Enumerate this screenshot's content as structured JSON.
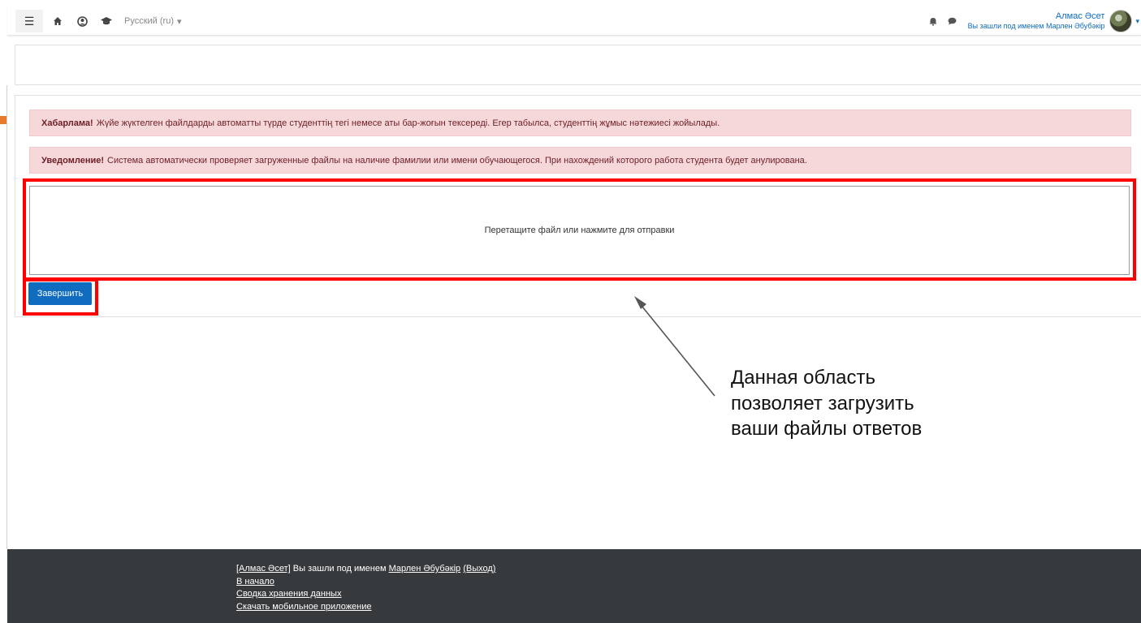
{
  "navbar": {
    "language": "Русский (ru)",
    "user_name": "Алмас Әсет",
    "logged_in_as": "Вы зашли под именем Марлен Әбубәкір"
  },
  "alerts": {
    "kz": {
      "label": "Хабарлама!",
      "text": "Жүйе жүктелген файлдарды автоматты түрде студенттің тегі немесе аты бар-жоғын тексереді. Егер табылса, студенттің жұмыс нәтежиесі жойылады."
    },
    "ru": {
      "label": "Уведомление!",
      "text": "Система автоматически проверяет загруженные файлы на наличие фамилии или имени обучающегося. При нахождений которого работа студента будет анулирована."
    }
  },
  "upload": {
    "dropzone_text": "Перетащите файл или нажмите для отправки",
    "finish_label": "Завершить"
  },
  "annotation": {
    "line1": "Данная область",
    "line2": "позволяет загрузить",
    "line3": "ваши файлы ответов"
  },
  "footer": {
    "user_link": "[Алмас Әсет]",
    "login_text": " Вы зашли под именем ",
    "login_user_link": "Марлен Әбубәкір",
    "logout_link": "(Выход)",
    "home_link": "В начало",
    "data_retention_link": "Сводка хранения данных",
    "mobile_app_link": "Скачать мобильное приложение"
  },
  "colors": {
    "primary": "#0f6cbf",
    "alert_bg": "#f6d8db",
    "alert_text": "#6e1d25",
    "highlight": "#ff0000",
    "footer_bg": "#373a3c"
  }
}
